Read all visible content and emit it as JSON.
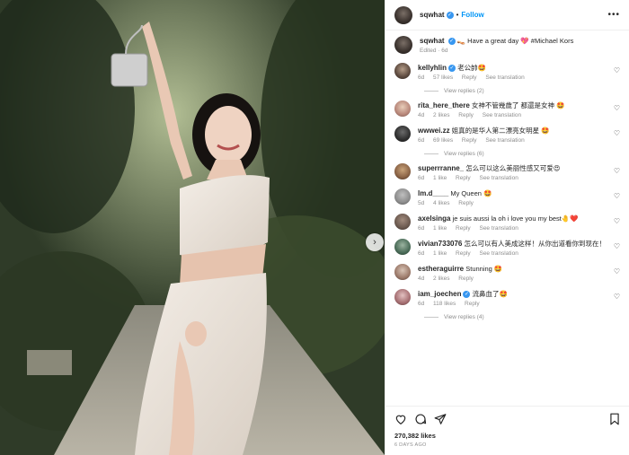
{
  "post": {
    "username": "sqwhat",
    "follow_label": "Follow",
    "separator": "•",
    "more_label": "•••",
    "next_arrow": "›"
  },
  "caption": {
    "username": "sqwhat",
    "text": "👡 Have a great day 💖 #Michael Kors",
    "edited": "Edited",
    "age": "6d"
  },
  "comments": [
    {
      "username": "kellyhlin",
      "verified": true,
      "text": "老公帥🤩",
      "age": "6d",
      "likes": "57 likes",
      "reply": "Reply",
      "translate": "See translation",
      "view_replies": "View replies (2)"
    },
    {
      "username": "rita_here_there",
      "verified": false,
      "text": "女神不管幾歲了 都還是女神 🤩",
      "age": "4d",
      "likes": "2 likes",
      "reply": "Reply",
      "translate": "See translation",
      "view_replies": ""
    },
    {
      "username": "wwwei.zz",
      "verified": false,
      "text": "姐真的是华人第二漂亮女明星 🤩",
      "age": "6d",
      "likes": "69 likes",
      "reply": "Reply",
      "translate": "See translation",
      "view_replies": "View replies (6)"
    },
    {
      "username": "superrranne_",
      "verified": false,
      "text": "怎么可以这么美丽性感又可爱😍",
      "age": "6d",
      "likes": "1 like",
      "reply": "Reply",
      "translate": "See translation",
      "view_replies": ""
    },
    {
      "username": "lm.d____",
      "verified": false,
      "text": "My Queen 🤩",
      "age": "5d",
      "likes": "4 likes",
      "reply": "Reply",
      "translate": "",
      "view_replies": ""
    },
    {
      "username": "axelsinga",
      "verified": false,
      "text": "je suis aussi la oh i love you my best🤚❤️",
      "age": "6d",
      "likes": "1 like",
      "reply": "Reply",
      "translate": "See translation",
      "view_replies": ""
    },
    {
      "username": "vivian733076",
      "verified": false,
      "text": "怎么可以有人美成这样！从你出道看你到现在！",
      "age": "6d",
      "likes": "1 like",
      "reply": "Reply",
      "translate": "See translation",
      "view_replies": ""
    },
    {
      "username": "estheraguirre",
      "verified": false,
      "text": "Stunning 🤩",
      "age": "4d",
      "likes": "2 likes",
      "reply": "Reply",
      "translate": "",
      "view_replies": ""
    },
    {
      "username": "iam_joechen",
      "verified": true,
      "text": "流鼻血了🤩",
      "age": "6d",
      "likes": "118 likes",
      "reply": "Reply",
      "translate": "",
      "view_replies": "View replies (4)"
    }
  ],
  "footer": {
    "likes": "270,382 likes",
    "date": "6 DAYS AGO"
  },
  "icons": {
    "like": "heart-icon",
    "comment": "comment-bubble-icon",
    "share": "paper-plane-icon",
    "save": "bookmark-icon",
    "next": "chevron-right-icon"
  },
  "colors": {
    "accent": "#0095f6",
    "verified": "#3897f0",
    "muted": "#8e8e8e"
  }
}
